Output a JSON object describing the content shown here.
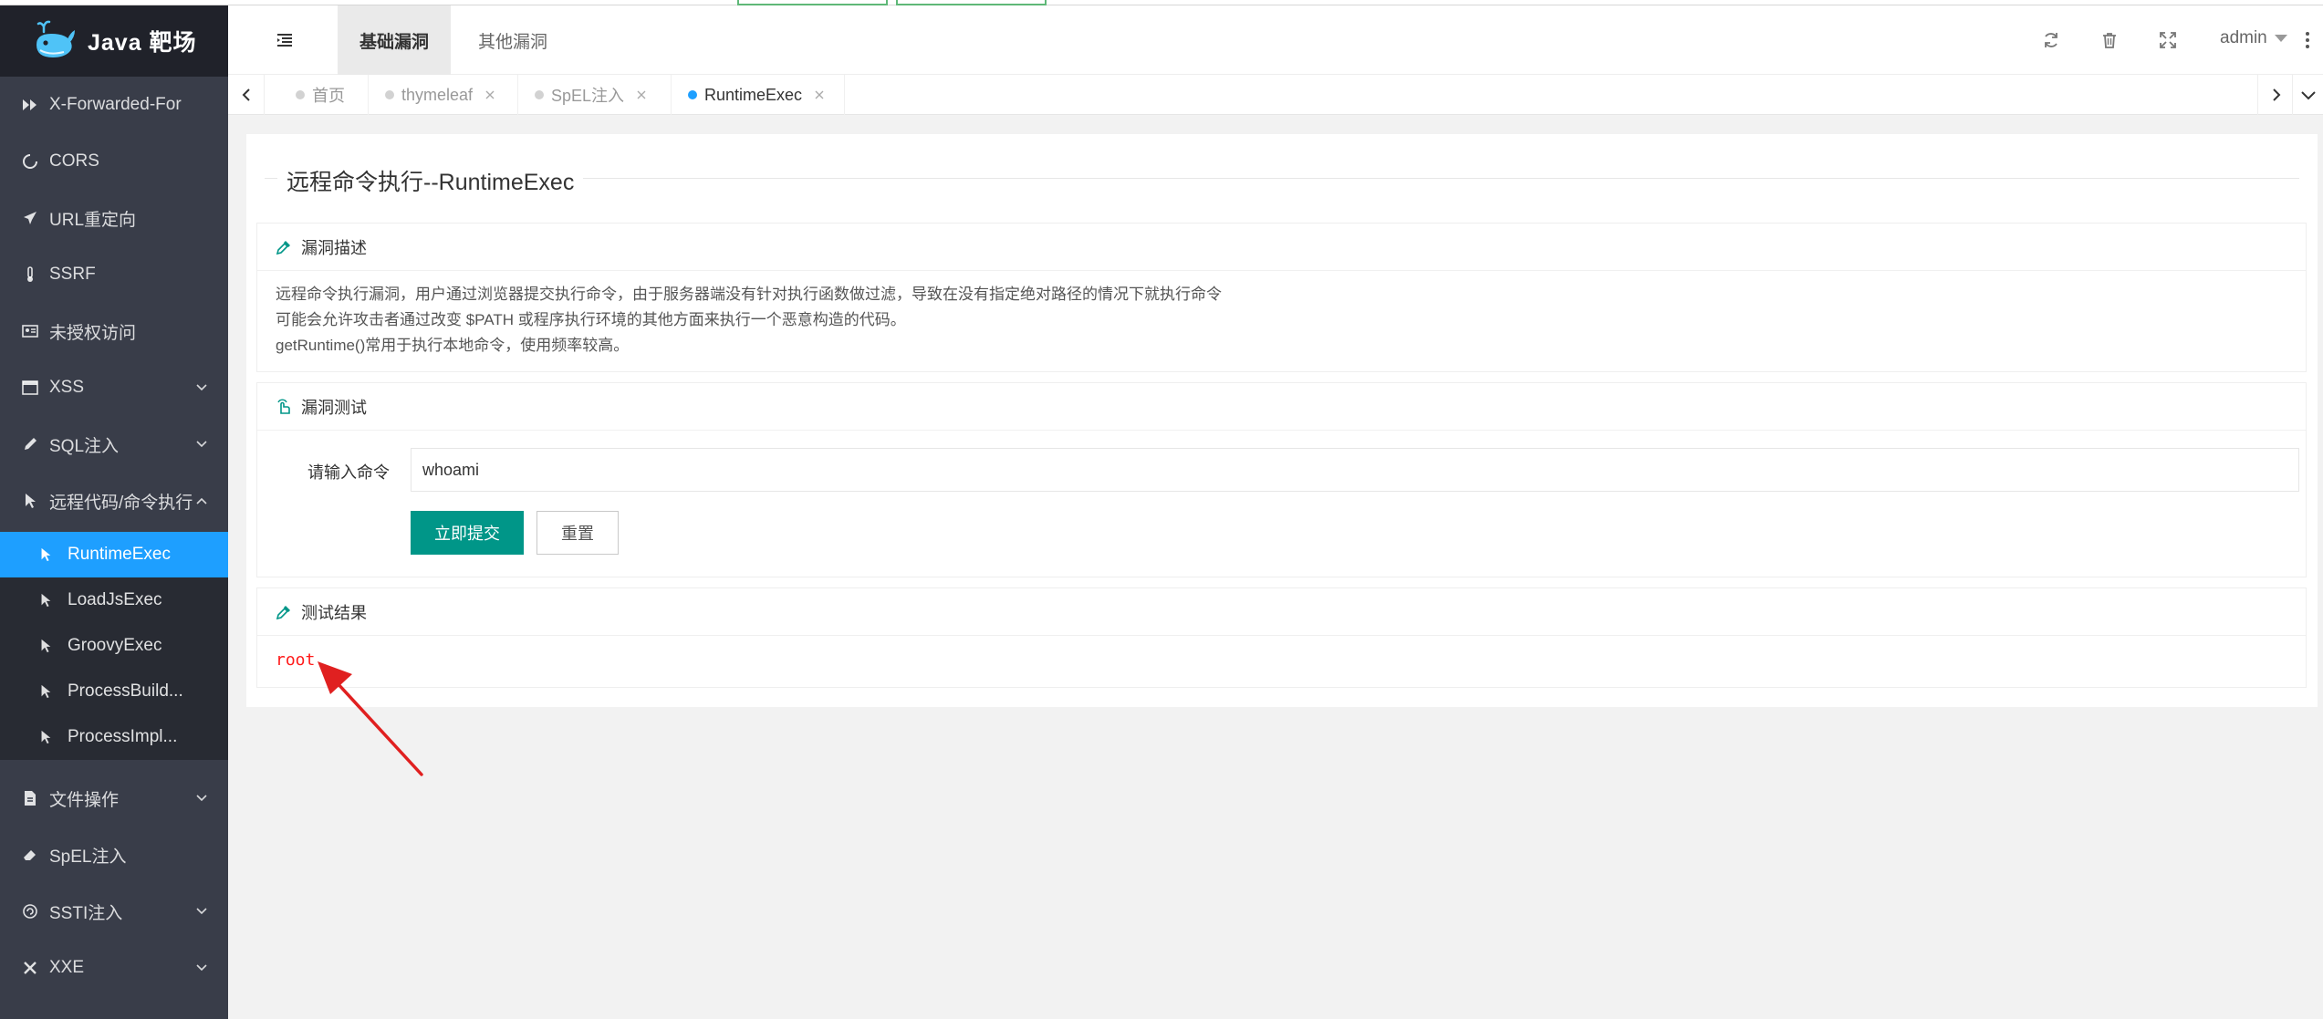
{
  "app": {
    "title": "Java 靶场"
  },
  "sidebar": {
    "items": [
      {
        "label": "X-Forwarded-For",
        "icon": "fast-forward-icon"
      },
      {
        "label": "CORS",
        "icon": "circle-refresh-icon"
      },
      {
        "label": "URL重定向",
        "icon": "airplane-icon"
      },
      {
        "label": "SSRF",
        "icon": "thermometer-icon"
      },
      {
        "label": "未授权访问",
        "icon": "id-card-icon"
      },
      {
        "label": "XSS",
        "icon": "window-icon"
      },
      {
        "label": "SQL注入",
        "icon": "pen-icon"
      },
      {
        "label": "远程代码/命令执行",
        "icon": "cursor-icon"
      }
    ],
    "sub_items": [
      {
        "label": "RuntimeExec"
      },
      {
        "label": "LoadJsExec"
      },
      {
        "label": "GroovyExec"
      },
      {
        "label": "ProcessBuild..."
      },
      {
        "label": "ProcessImpl..."
      }
    ],
    "items_after": [
      {
        "label": "文件操作",
        "icon": "file-icon"
      },
      {
        "label": "SpEL注入",
        "icon": "eraser-icon"
      },
      {
        "label": "SSTI注入",
        "icon": "swirl-icon"
      },
      {
        "label": "XXE",
        "icon": "wrench-cross-icon"
      }
    ]
  },
  "header": {
    "tabs": [
      {
        "label": "基础漏洞"
      },
      {
        "label": "其他漏洞"
      }
    ],
    "user": "admin"
  },
  "page_tabs": [
    {
      "label": "首页"
    },
    {
      "label": "thymeleaf"
    },
    {
      "label": "SpEL注入"
    },
    {
      "label": "RuntimeExec"
    }
  ],
  "content": {
    "title": "远程命令执行--RuntimeExec",
    "desc_panel": {
      "heading": "漏洞描述",
      "lines": [
        "远程命令执行漏洞，用户通过浏览器提交执行命令，由于服务器端没有针对执行函数做过滤，导致在没有指定绝对路径的情况下就执行命令",
        "可能会允许攻击者通过改变 $PATH 或程序执行环境的其他方面来执行一个恶意构造的代码。",
        "getRuntime()常用于执行本地命令，使用频率较高。"
      ]
    },
    "test_panel": {
      "heading": "漏洞测试",
      "input_label": "请输入命令",
      "input_value": "whoami",
      "submit_label": "立即提交",
      "reset_label": "重置"
    },
    "result_panel": {
      "heading": "测试结果",
      "output": "root"
    }
  },
  "colors": {
    "sidebar_bg": "#393d49",
    "logo_bg": "#20222a",
    "active_blue": "#1e9fff",
    "primary_green": "#009688",
    "result_red": "#ff1a1a"
  }
}
